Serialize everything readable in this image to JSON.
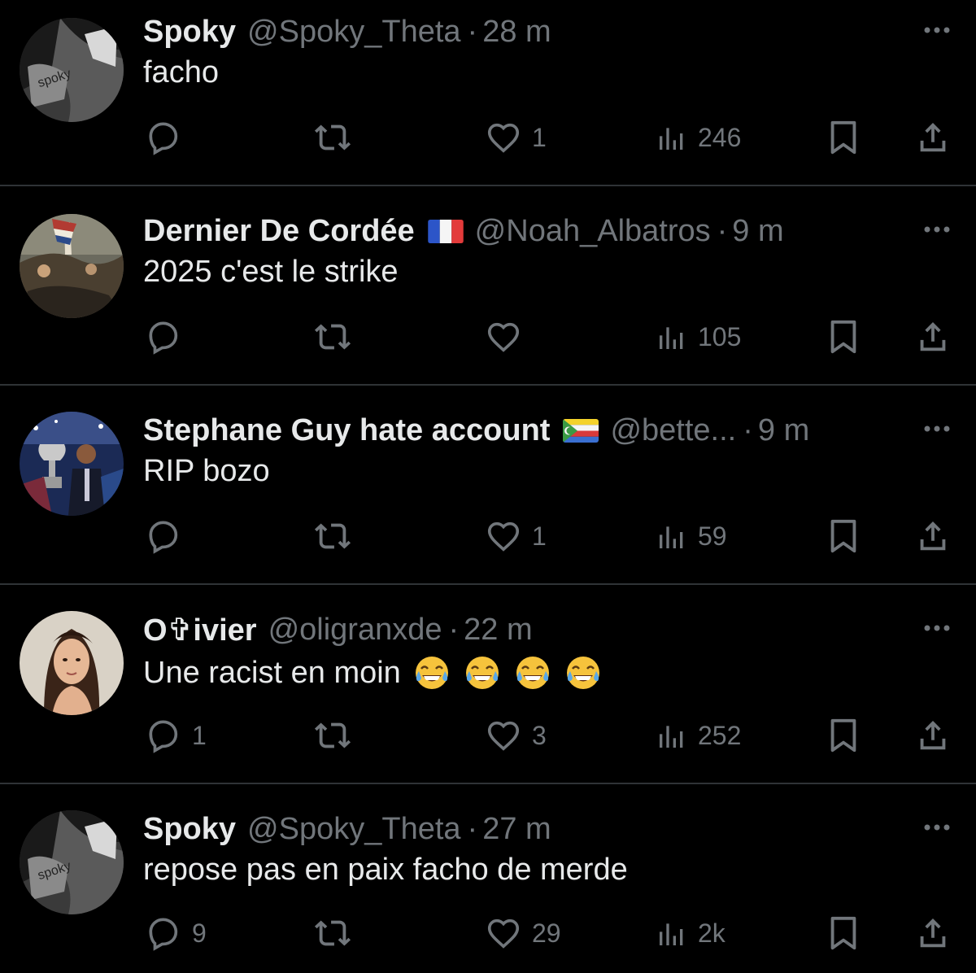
{
  "theme": {
    "background": "#000000",
    "text": "#e7e9ea",
    "muted": "#71767b",
    "divider": "#2f3336"
  },
  "replies": [
    {
      "name": "Spoky",
      "flag": "",
      "handle": "@Spoky_Theta",
      "separator": "·",
      "time": "28 m",
      "text": "facho",
      "emoji_count": 0,
      "avatar_icon": "spoky-avatar",
      "avatar_text": "spoky",
      "metrics": {
        "replies": "",
        "retweets": "",
        "likes": "1",
        "views": "246"
      }
    },
    {
      "name": "Dernier De Cordée",
      "flag": "france-flag",
      "handle": "@Noah_Albatros",
      "separator": "·",
      "time": "9 m",
      "text": "2025 c'est le strike",
      "emoji_count": 0,
      "avatar_icon": "painting-avatar",
      "metrics": {
        "replies": "",
        "retweets": "",
        "likes": "",
        "views": "105"
      }
    },
    {
      "name": "Stephane Guy hate account",
      "flag": "comoros-flag",
      "handle": "@bette...",
      "separator": "·",
      "time": "9 m",
      "text": "RIP bozo",
      "emoji_count": 0,
      "avatar_icon": "trophy-avatar",
      "metrics": {
        "replies": "",
        "retweets": "",
        "likes": "1",
        "views": "59"
      }
    },
    {
      "name": "O✞ivier",
      "flag": "",
      "handle": "@oligranxde",
      "separator": "·",
      "time": "22 m",
      "text": "Une racist en moin",
      "emoji_count": 4,
      "emoji_icon": "face-with-tears-of-joy-emoji",
      "avatar_icon": "portrait-avatar",
      "metrics": {
        "replies": "1",
        "retweets": "",
        "likes": "3",
        "views": "252"
      }
    },
    {
      "name": "Spoky",
      "flag": "",
      "handle": "@Spoky_Theta",
      "separator": "·",
      "time": "27 m",
      "text": "repose pas en paix facho de merde",
      "emoji_count": 0,
      "avatar_icon": "spoky-avatar",
      "avatar_text": "spoky",
      "metrics": {
        "replies": "9",
        "retweets": "",
        "likes": "29",
        "views": "2k"
      }
    }
  ]
}
